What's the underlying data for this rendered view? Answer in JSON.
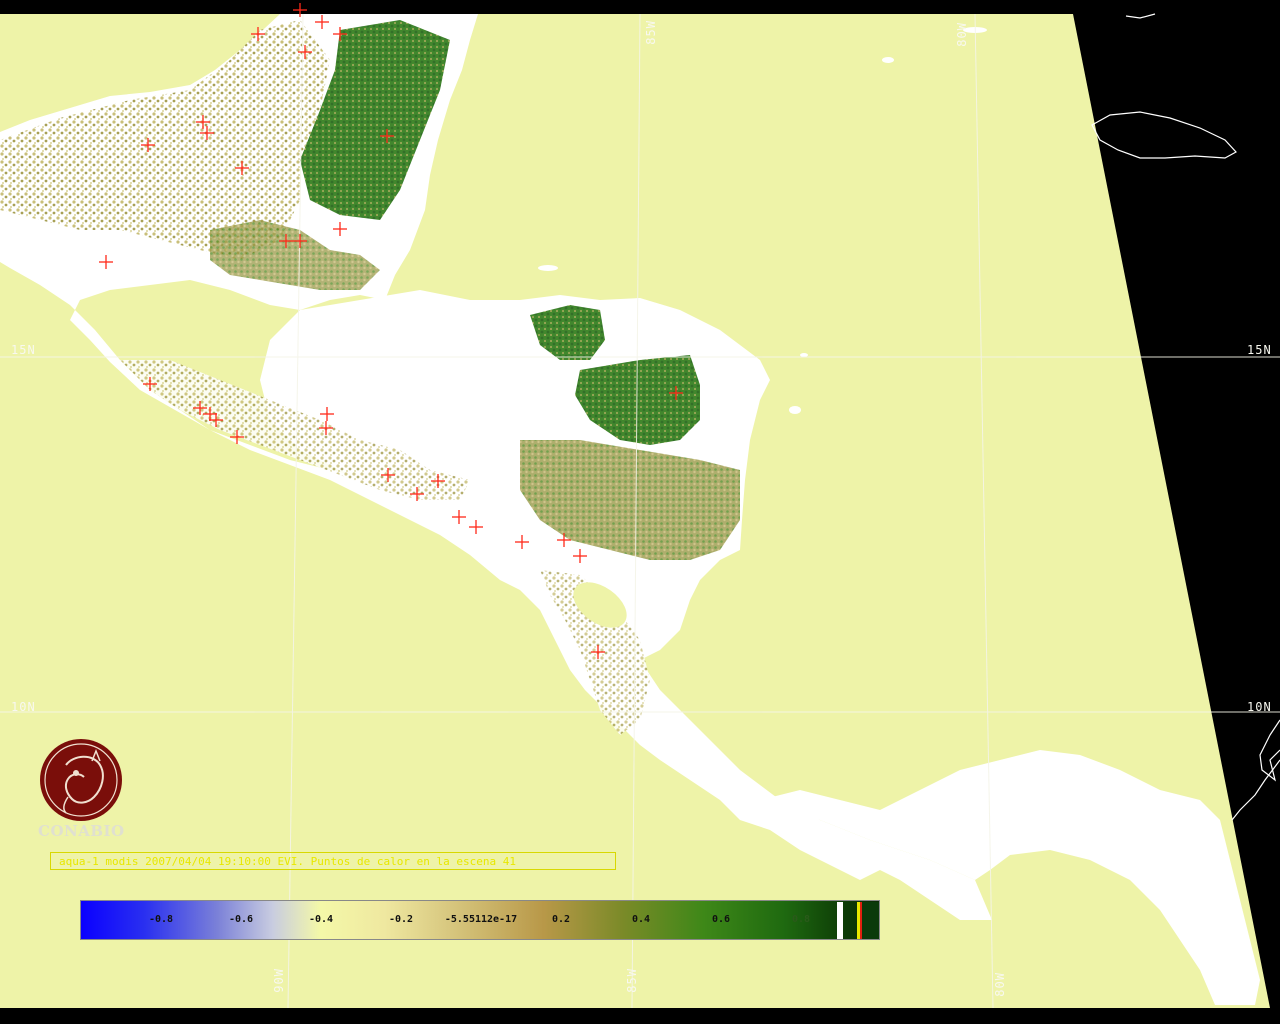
{
  "map": {
    "background_color": "#000000",
    "sea_color": "#eef3a8",
    "land_color": "#ffffff",
    "vegetation_colors": [
      "#b7ae62",
      "#8a9a3a",
      "#3f7f1c",
      "#1e6a12"
    ],
    "hotspot_color": "#ff2a1a",
    "grid_color": "#f4f4e8",
    "graticule_labels": {
      "lat_15_left": "15N",
      "lat_15_right": "15N",
      "lat_10_left": "10N",
      "lat_10_right": "10N",
      "lon_85_top": "85W",
      "lon_80_top": "80W",
      "lon_90_bottom": "90W",
      "lon_85_bottom": "85W",
      "lon_80_bottom": "80W"
    },
    "hotspot_count": 41
  },
  "logo": {
    "text": "CONABIO",
    "color": "#7a0e0a"
  },
  "caption": {
    "text": "aqua-1 modis 2007/04/04 19:10:00 EVI. Puntos de calor en la escena 41"
  },
  "colorbar": {
    "tick_labels": [
      "-0.8",
      "-0.6",
      "-0.4",
      "-0.2",
      "-5.55112e-17",
      "0.2",
      "0.4",
      "0.6",
      "0.8"
    ],
    "range": [
      -1,
      1
    ]
  }
}
